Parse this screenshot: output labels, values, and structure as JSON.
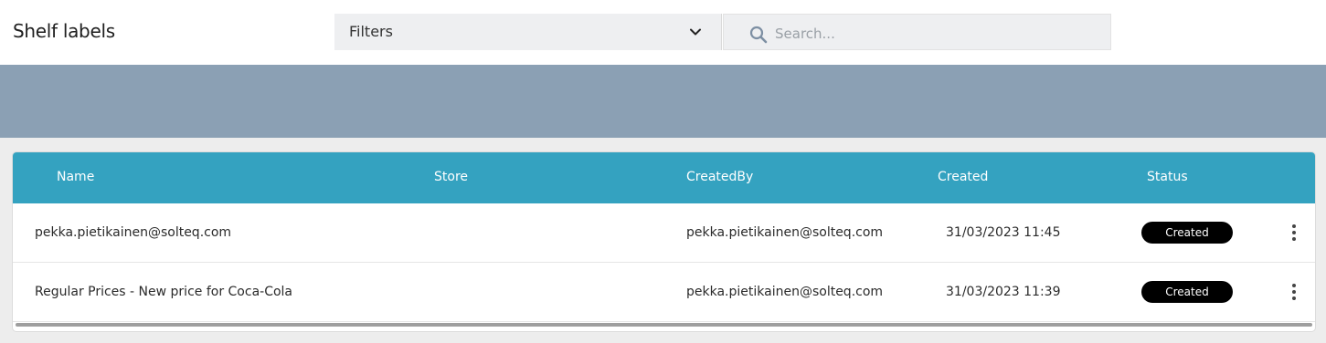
{
  "header": {
    "title": "Shelf labels",
    "filters_label": "Filters",
    "search_placeholder": "Search..."
  },
  "table": {
    "columns": [
      "Name",
      "Store",
      "CreatedBy",
      "Created",
      "Status"
    ],
    "rows": [
      {
        "name": "pekka.pietikainen@solteq.com",
        "store": "",
        "created_by": "pekka.pietikainen@solteq.com",
        "created": "31/03/2023 11:45",
        "status": "Created"
      },
      {
        "name": "Regular Prices - New price for Coca-Cola",
        "store": "",
        "created_by": "pekka.pietikainen@solteq.com",
        "created": "31/03/2023 11:39",
        "status": "Created"
      }
    ]
  },
  "icons": {
    "filters": "chevron-down-icon",
    "search": "search-icon",
    "row_menu": "more-vertical-icon"
  },
  "colors": {
    "table_header": "#34a2c0",
    "banner": "#8ba0b4",
    "status_badge": "#000000"
  }
}
